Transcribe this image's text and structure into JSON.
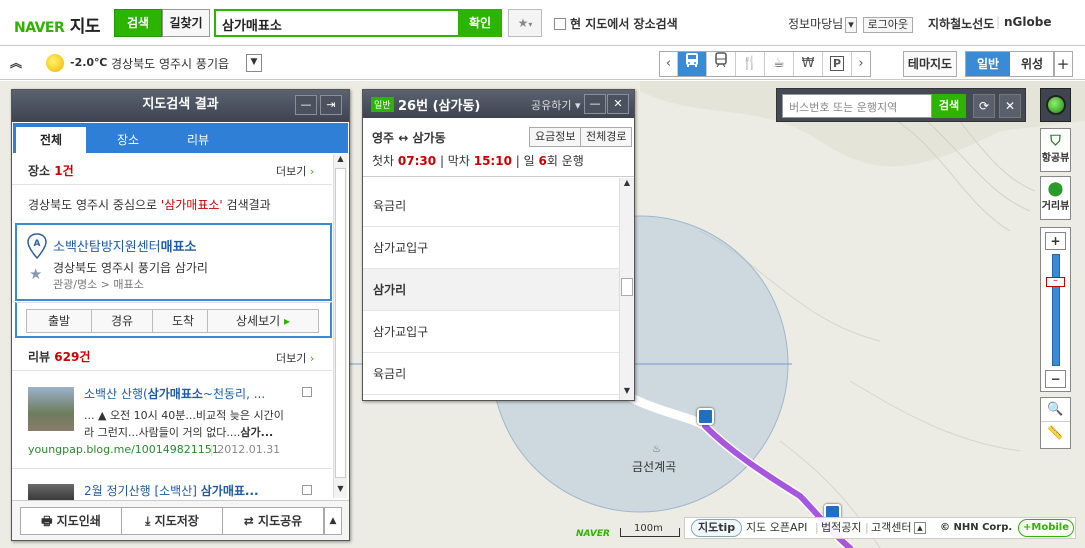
{
  "header": {
    "logo_naver": "NAVER",
    "logo_map": "지도",
    "search_tab": "검색",
    "route_tab": "길찾기",
    "search_value": "삼가매표소",
    "confirm": "확인",
    "area_search": "현 지도에서 장소검색",
    "user": "정보마당님",
    "logout": "로그아웃",
    "subway": "지하철노선도",
    "nglobe": "nGlobe"
  },
  "bar2": {
    "temp": "-2.0℃",
    "location": "경상북도 영주시 풍기읍",
    "theme": "테마지도",
    "normal": "일반",
    "satellite": "위성"
  },
  "left_panel": {
    "title": "지도검색 결과",
    "tabs": [
      "전체",
      "장소",
      "리뷰"
    ],
    "place_label": "장소",
    "place_count": "1건",
    "more": "더보기",
    "scope_prefix": "경상북도 영주시 중심으로",
    "scope_query": "'삼가매표소'",
    "scope_suffix": "검색결과",
    "result": {
      "marker": "A",
      "name": "소백산탐방지원센터",
      "name_highlight": "매표소",
      "address": "경상북도 영주시 풍기읍 삼가리",
      "category": "관광/명소 > 매표소"
    },
    "actions": [
      "출발",
      "경유",
      "도착",
      "상세보기"
    ],
    "review_label": "리뷰",
    "review_count": "629건",
    "reviews": [
      {
        "title_prefix": "소백산 산행(",
        "title_highlight": "삼가매표소",
        "title_suffix": "~천동리, ...",
        "body_line1": "... ▲ 오전 10시 40분...비교적 늦은 시간이",
        "body_line2_prefix": "라 그런지...사람들이 거의 없다....",
        "body_line2_highlight": "삼가...",
        "url": "youngpap.blog.me/100149821151",
        "date": "2012.01.31"
      },
      {
        "title_prefix": "2월 정기산행 [소백산] ",
        "title_highlight": "삼가매표...",
        "title_suffix": ""
      }
    ],
    "footer": [
      "지도인쇄",
      "지도저장",
      "지도공유"
    ]
  },
  "bus_panel": {
    "badge": "일반",
    "title": "26번 (삼가동)",
    "share": "공유하기",
    "route": "영주 ↔ 삼가동",
    "fare": "요금정보",
    "full_route": "전체경로",
    "first_label": "첫차",
    "first_time": "07:30",
    "last_label": "막차",
    "last_time": "15:10",
    "runs_prefix": "일",
    "runs_count": "6",
    "runs_suffix": "회 운행",
    "stops": [
      "육금리",
      "삼가교입구",
      "삼가리",
      "삼가교입구",
      "육금리"
    ]
  },
  "map": {
    "bus_search_placeholder": "버스번호 또는 운행지역",
    "bus_search_button": "검색",
    "aerial_view": "항공뷰",
    "street_view": "거리뷰",
    "place_label": "금선계곡",
    "scale_brand": "NAVER",
    "scale": "100m",
    "circle_color": "#b4c9da",
    "route_color": "#a855e0"
  },
  "footer": {
    "tip": "지도tip",
    "api": "지도 오픈API",
    "legal": "법적공지",
    "support": "고객센터",
    "copyright": "© NHN Corp.",
    "mobile": "+Mobile"
  }
}
